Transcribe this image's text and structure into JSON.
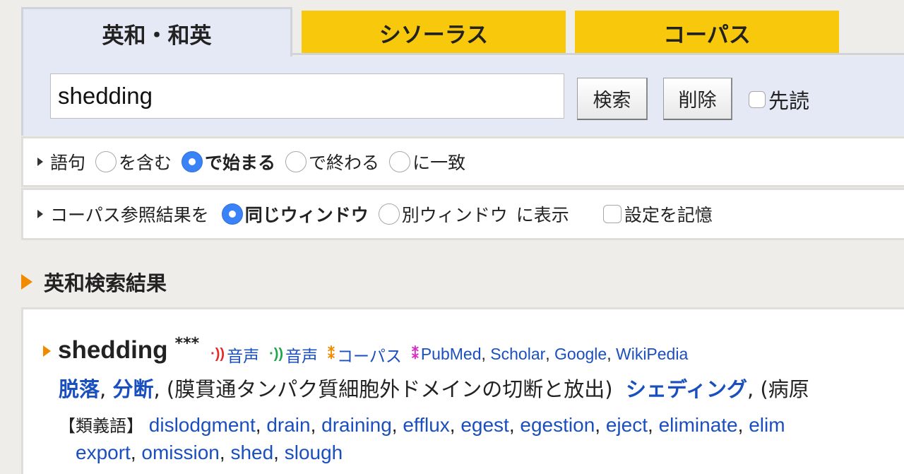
{
  "tabs": [
    {
      "label": "英和・和英",
      "active": true
    },
    {
      "label": "シソーラス",
      "active": false
    },
    {
      "label": "コーパス",
      "active": false
    }
  ],
  "search": {
    "value": "shedding",
    "search_button": "検索",
    "clear_button": "削除",
    "prefetch_label": "先読"
  },
  "phrase_options": {
    "lead": "語句",
    "options": [
      {
        "label": "を含む",
        "checked": false
      },
      {
        "label": "で始まる",
        "checked": true
      },
      {
        "label": "で終わる",
        "checked": false
      },
      {
        "label": "に一致",
        "checked": false
      }
    ]
  },
  "corpus_options": {
    "lead": "コーパス参照結果を",
    "options": [
      {
        "label": "同じウィンドウ",
        "checked": true
      },
      {
        "label": "別ウィンドウ",
        "checked": false
      }
    ],
    "suffix": "に表示",
    "remember_label": "設定を記憶"
  },
  "results": {
    "section_title": "英和検索結果",
    "entry": {
      "headword": "shedding",
      "stars": "***",
      "links": [
        {
          "icon": "speaker-red-icon",
          "label": "音声"
        },
        {
          "icon": "speaker-green-icon",
          "label": "音声"
        },
        {
          "icon": "corpus-icon",
          "label": "コーパス"
        },
        {
          "icon": "pubmed-icon",
          "label": "PubMed"
        }
      ],
      "extra_links": [
        "Scholar",
        "Google",
        "WikiPedia"
      ],
      "meaning_terms": [
        "脱落",
        "分断"
      ],
      "meaning_note": "(膜貫通タンパク質細胞外ドメインの切断と放出)",
      "meaning_term2": "シェディング",
      "meaning_note2": "(病原",
      "synonym_label": "【類義語】",
      "synonyms_line1": [
        "dislodgment",
        "drain",
        "draining",
        "efflux",
        "egest",
        "egestion",
        "eject",
        "eliminate",
        "elim"
      ],
      "synonyms_line2": [
        "export",
        "omission",
        "shed",
        "slough"
      ]
    }
  },
  "colors": {
    "tab_active_bg": "#e4e9f5",
    "tab_inactive_bg": "#f7c80b",
    "link": "#1a4fc0",
    "accent_orange": "#f28a00",
    "radio_checked": "#3a82f7"
  }
}
